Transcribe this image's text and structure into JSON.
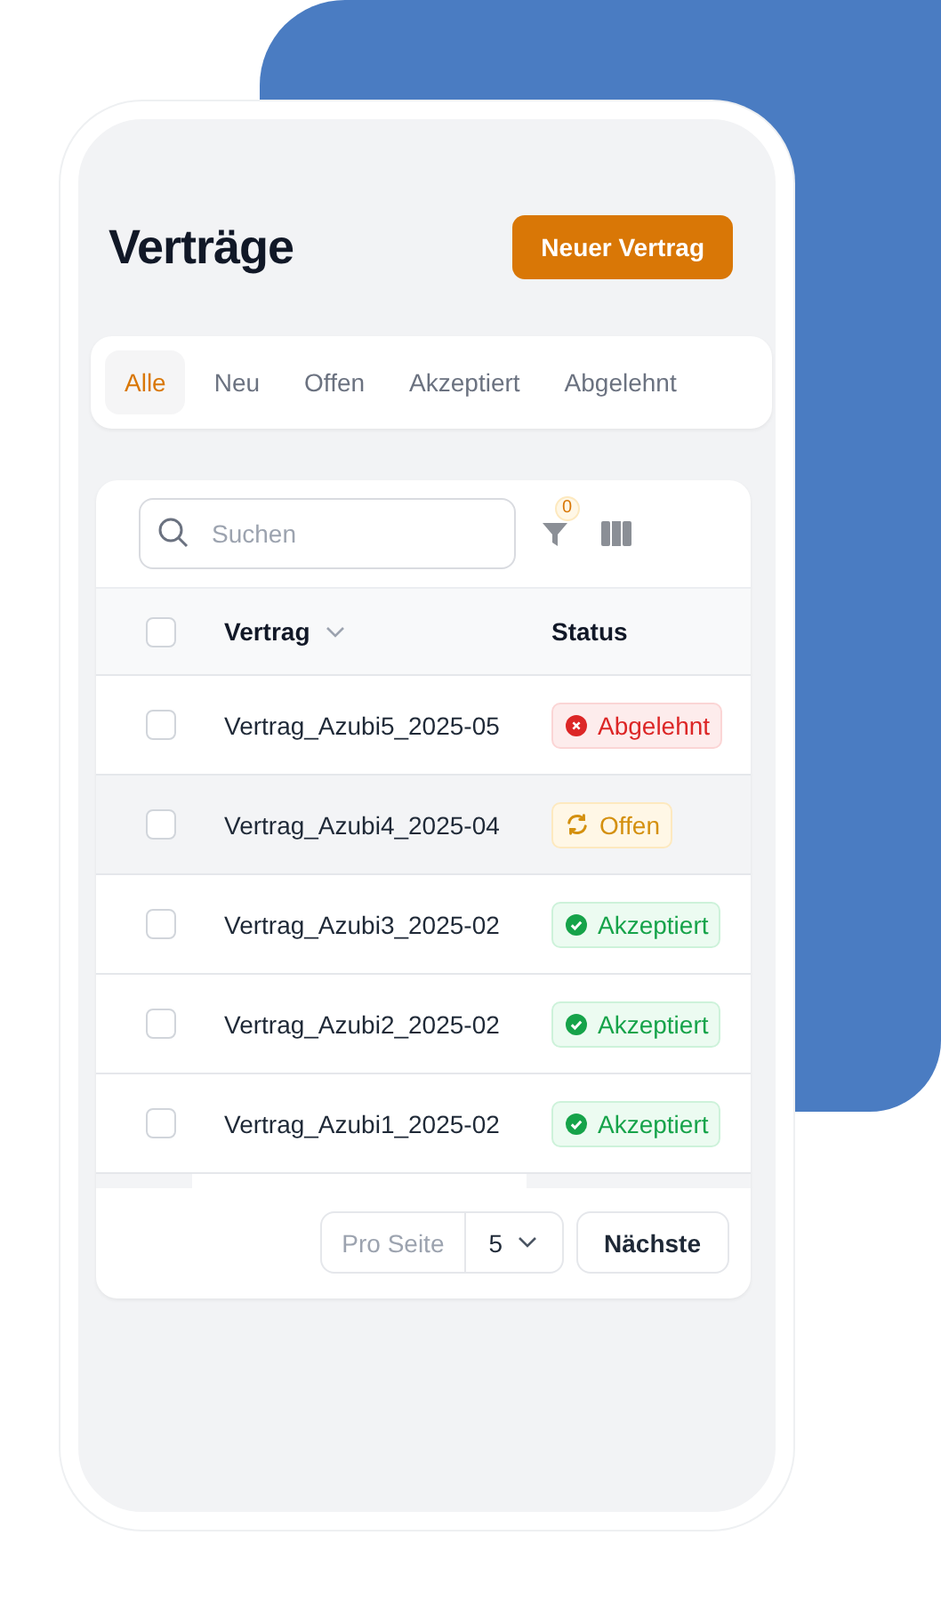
{
  "page": {
    "title": "Verträge",
    "new_button": "Neuer Vertrag"
  },
  "tabs": [
    {
      "label": "Alle",
      "selected": true
    },
    {
      "label": "Neu",
      "selected": false
    },
    {
      "label": "Offen",
      "selected": false
    },
    {
      "label": "Akzeptiert",
      "selected": false
    },
    {
      "label": "Abgelehnt",
      "selected": false
    }
  ],
  "toolbar": {
    "search": {
      "placeholder": "Suchen"
    },
    "filter_count": "0"
  },
  "table": {
    "columns": [
      {
        "label": "Vertrag",
        "sortable": true
      },
      {
        "label": "Status",
        "sortable": false
      }
    ],
    "header_checked": false,
    "rows": [
      {
        "name": "Vertrag_Azubi5_2025-05",
        "status": "Abgelehnt",
        "kind": "rejected",
        "checked": false,
        "highlighted": false
      },
      {
        "name": "Vertrag_Azubi4_2025-04",
        "status": "Offen",
        "kind": "open",
        "checked": false,
        "highlighted": true
      },
      {
        "name": "Vertrag_Azubi3_2025-02",
        "status": "Akzeptiert",
        "kind": "accepted",
        "checked": false,
        "highlighted": false
      },
      {
        "name": "Vertrag_Azubi2_2025-02",
        "status": "Akzeptiert",
        "kind": "accepted",
        "checked": false,
        "highlighted": false
      },
      {
        "name": "Vertrag_Azubi1_2025-02",
        "status": "Akzeptiert",
        "kind": "accepted",
        "checked": false,
        "highlighted": false
      }
    ]
  },
  "pagination": {
    "per_page_label": "Pro Seite",
    "per_page_value": "5",
    "next_button": "Nächste"
  }
}
